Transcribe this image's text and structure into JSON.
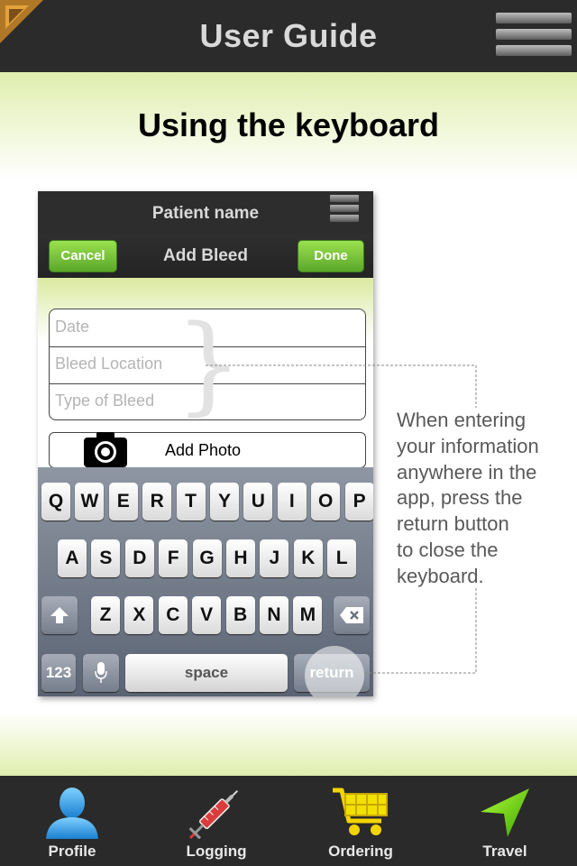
{
  "header": {
    "title": "User Guide"
  },
  "page": {
    "heading": "Using the keyboard"
  },
  "phone": {
    "title": "Patient name",
    "nav": {
      "cancel_label": "Cancel",
      "title": "Add Bleed",
      "done_label": "Done"
    },
    "fields": [
      {
        "placeholder": "Date"
      },
      {
        "placeholder": "Bleed Location"
      },
      {
        "placeholder": "Type of Bleed"
      }
    ],
    "add_photo_label": "Add Photo",
    "keyboard": {
      "row1": [
        "Q",
        "W",
        "E",
        "R",
        "T",
        "Y",
        "U",
        "I",
        "O",
        "P"
      ],
      "row2": [
        "A",
        "S",
        "D",
        "F",
        "G",
        "H",
        "J",
        "K",
        "L"
      ],
      "row3": [
        "Z",
        "X",
        "C",
        "V",
        "B",
        "N",
        "M"
      ],
      "numbers_label": "123",
      "space_label": "space",
      "return_label": "return"
    }
  },
  "instruction": {
    "lines": [
      "When entering",
      "your information",
      "anywhere in the",
      "app, press the",
      "return button",
      "to close the",
      "keyboard."
    ]
  },
  "tabbar": {
    "items": [
      {
        "label": "Profile",
        "icon": "person-icon"
      },
      {
        "label": "Logging",
        "icon": "syringe-icon"
      },
      {
        "label": "Ordering",
        "icon": "cart-icon"
      },
      {
        "label": "Travel",
        "icon": "location-arrow-icon"
      }
    ]
  },
  "colors": {
    "accent_green": "#5aa72a",
    "background_tint": "#e0eeae",
    "bar_dark": "#2b2b2b"
  }
}
